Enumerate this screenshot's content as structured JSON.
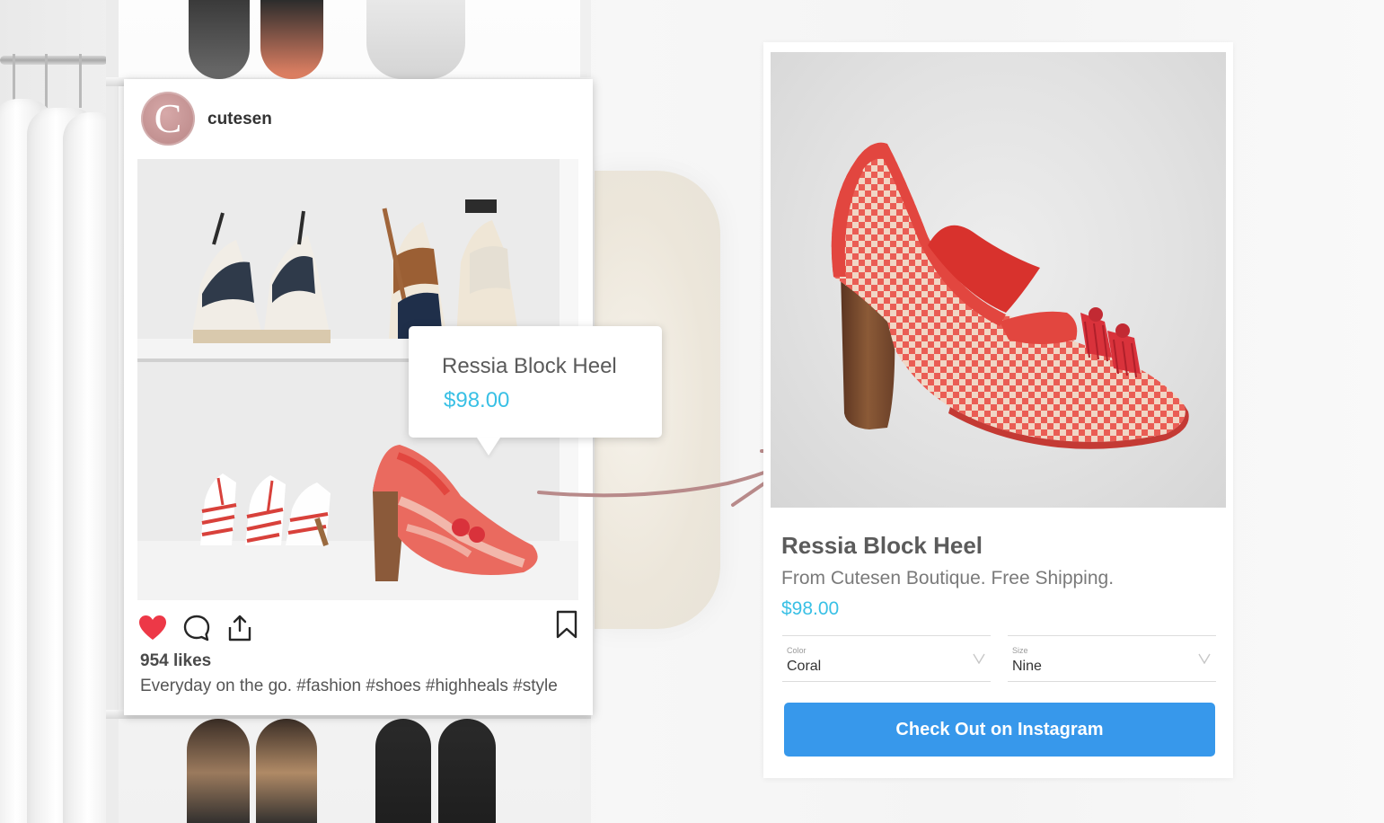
{
  "post": {
    "username": "cutesen",
    "avatar_letter": "C",
    "likes": "954 likes",
    "caption": "Everyday on the go. #fashion #shoes #highheals #style",
    "liked": true,
    "icons": {
      "like": "heart-icon",
      "comment": "comment-icon",
      "share": "share-icon",
      "save": "bookmark-icon"
    }
  },
  "tag_tooltip": {
    "name": "Ressia Block Heel",
    "price": "$98.00"
  },
  "product": {
    "title": "Ressia Block Heel",
    "subtitle": "From Cutesen Boutique. Free Shipping.",
    "price": "$98.00",
    "color_select": {
      "label": "Color",
      "value": "Coral"
    },
    "size_select": {
      "label": "Size",
      "value": "Nine"
    },
    "checkout_label": "Check Out on Instagram"
  },
  "colors": {
    "price_accent": "#39c0e5",
    "cta_blue": "#3798eb",
    "heart_red": "#ed3847",
    "avatar_pink": "#c49393",
    "arrow_mauve": "#b88a8a",
    "shoe_coral": "#e8524c"
  }
}
